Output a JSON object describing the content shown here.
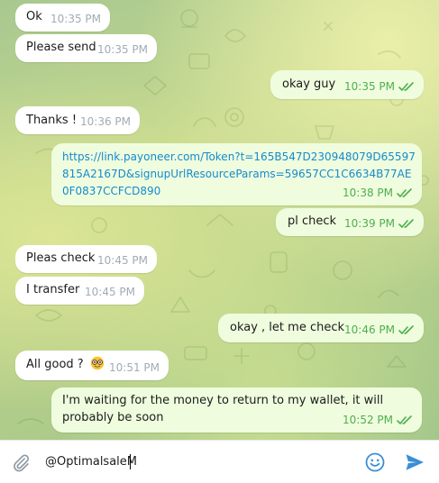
{
  "messages": [
    {
      "dir": "in",
      "text": "Ok",
      "time": "10:35 PM"
    },
    {
      "dir": "in",
      "text": "Please send",
      "time": "10:35 PM"
    },
    {
      "dir": "out",
      "text": "okay guy",
      "time": "10:35 PM",
      "read": true
    },
    {
      "dir": "in",
      "text": "Thanks !",
      "time": "10:36 PM"
    },
    {
      "dir": "out",
      "text": "https://link.payoneer.com/Token?t=165B547D230948079D65597815A2167D&signupUrlResourceParams=59657CC1C6634B77AE0F0837CCFCD890",
      "time": "10:38 PM",
      "read": true,
      "is_link": true
    },
    {
      "dir": "out",
      "text": "pl check",
      "time": "10:39 PM",
      "read": true
    },
    {
      "dir": "in",
      "text": "Pleas check",
      "time": "10:45 PM"
    },
    {
      "dir": "in",
      "text": "I transfer",
      "time": "10:45 PM"
    },
    {
      "dir": "out",
      "text": "okay , let me check",
      "time": "10:46 PM",
      "read": true
    },
    {
      "dir": "in",
      "text": "All good ?",
      "time": "10:51 PM",
      "emoji": "nerd-face-emoji"
    },
    {
      "dir": "out",
      "text": "I'm waiting for the money to return to my wallet, it will probably be soon",
      "time": "10:52 PM",
      "read": true
    }
  ],
  "composer": {
    "value": "@OptimalsaleM",
    "attach_icon": "paperclip-icon",
    "emoji_icon": "smiley-icon",
    "send_icon": "send-icon"
  },
  "colors": {
    "incoming_bubble": "#ffffff",
    "outgoing_bubble": "#effdde",
    "outgoing_meta": "#4fae4e",
    "incoming_meta": "#a0acb6",
    "link": "#168acd",
    "accent": "#3a8fd6"
  }
}
